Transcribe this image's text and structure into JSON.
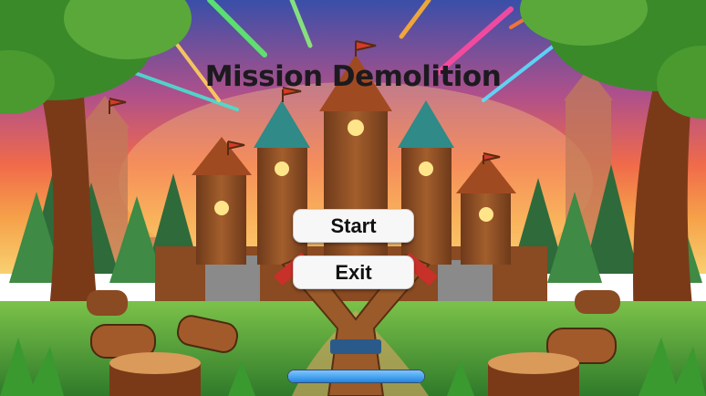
{
  "game": {
    "title": "Mission Demolition",
    "start_label": "Start",
    "exit_label": "Exit",
    "loading_progress": 1.0
  },
  "colors": {
    "sky_top": "#3a4fa8",
    "sky_horizon": "#f6a24a",
    "grass": "#4fa83a",
    "wood": "#8a4a22",
    "roof_teal": "#2f8a88",
    "flag_red": "#d63a2a",
    "progress_blue": "#1f86e0"
  }
}
